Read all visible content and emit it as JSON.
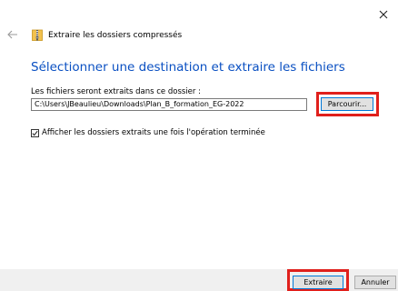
{
  "window": {
    "title": "Extraire les dossiers compressés"
  },
  "heading": "Sélectionner une destination et extraire les fichiers",
  "destination": {
    "label": "Les fichiers seront extraits dans ce dossier :",
    "path": "C:\\Users\\JBeaulieu\\Downloads\\Plan_B_formation_EG-2022",
    "browse_label": "Parcourir..."
  },
  "show_extracted": {
    "label": "Afficher les dossiers extraits une fois l'opération terminée",
    "checked": true
  },
  "footer": {
    "extract_label": "Extraire",
    "cancel_label": "Annuler"
  },
  "colors": {
    "heading": "#0a50c2",
    "highlight": "#e0201c",
    "button_focus_border": "#0078d7"
  }
}
